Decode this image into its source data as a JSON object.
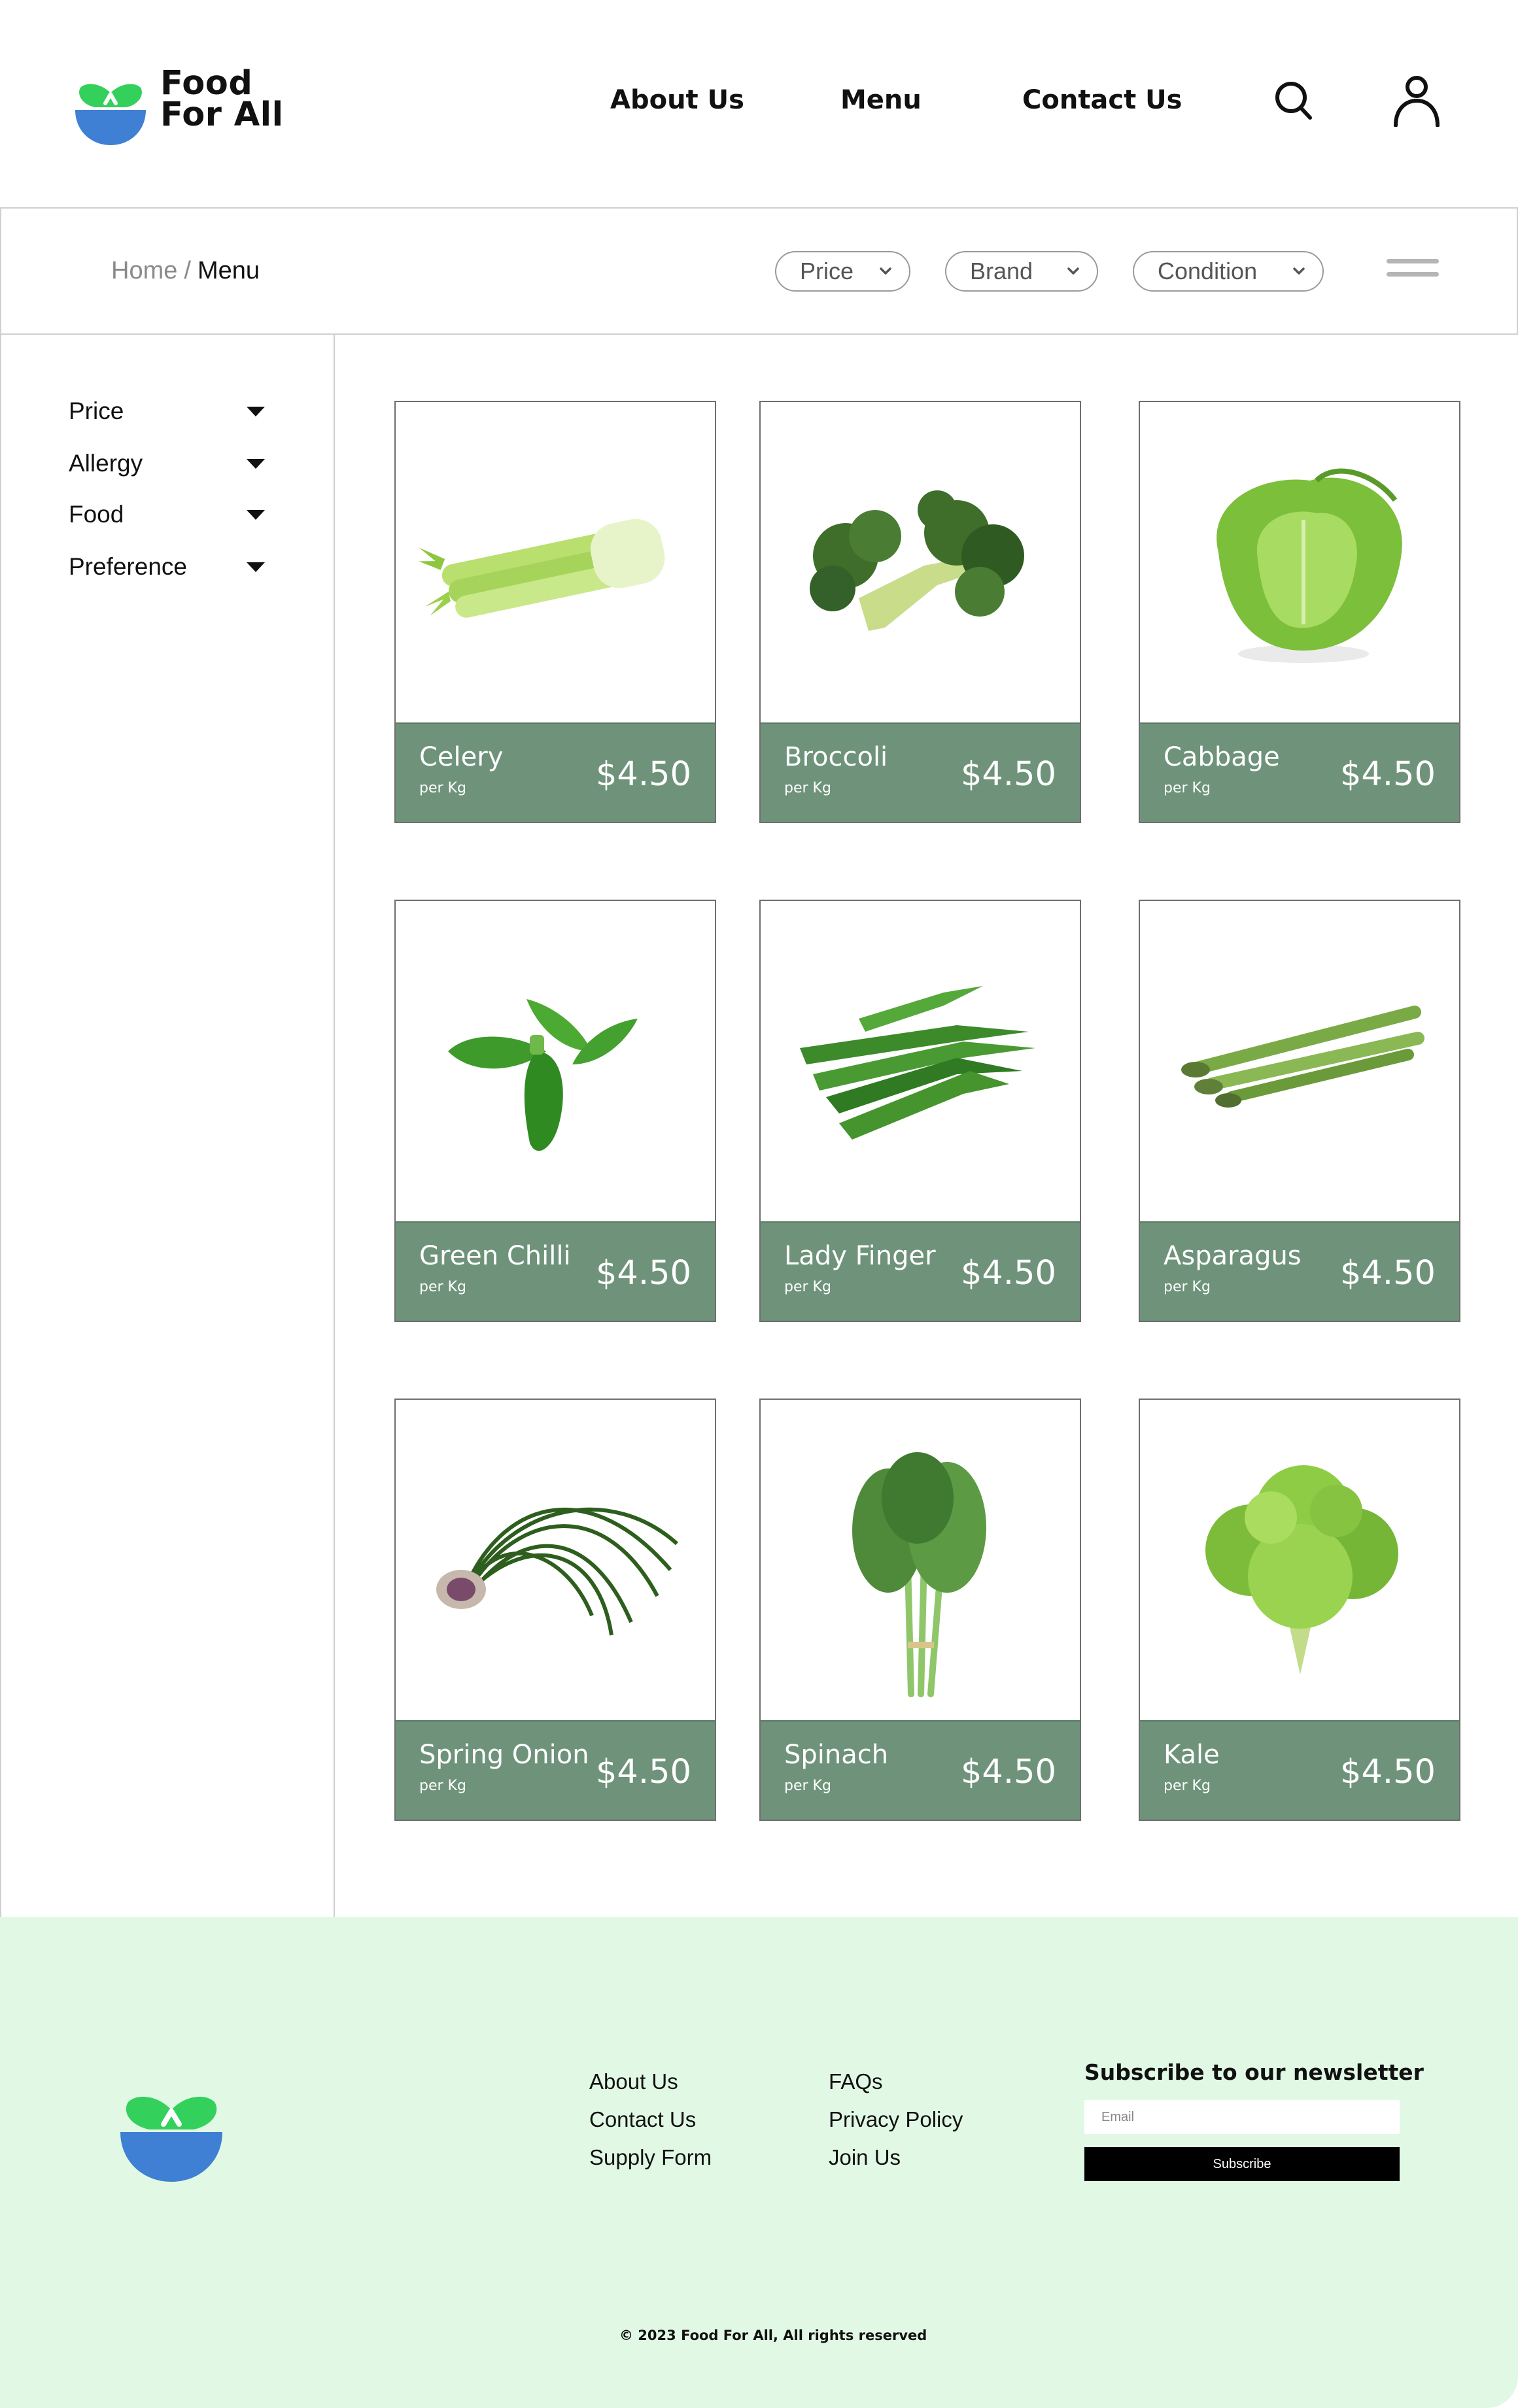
{
  "brand": {
    "line1": "Food",
    "line2": "For All",
    "green": "#33d15c",
    "blue": "#3f7fd4"
  },
  "nav": {
    "about": "About Us",
    "menu": "Menu",
    "contact": "Contact Us"
  },
  "header_icons": {
    "search": "search-icon",
    "user": "user-icon"
  },
  "breadcrumb": {
    "home": "Home",
    "separator": "/",
    "current": "Menu"
  },
  "toolbar_filters": [
    "Price",
    "Brand",
    "Condition"
  ],
  "sidebar_filters": [
    "Price",
    "Allergy",
    "Food",
    "Preference"
  ],
  "card_bar_color": "#6e937a",
  "products": [
    {
      "name": "Celery",
      "unit": "per Kg",
      "price": "$4.50"
    },
    {
      "name": "Broccoli",
      "unit": "per Kg",
      "price": "$4.50"
    },
    {
      "name": "Cabbage",
      "unit": "per Kg",
      "price": "$4.50"
    },
    {
      "name": "Green Chilli",
      "unit": "per Kg",
      "price": "$4.50"
    },
    {
      "name": "Lady Finger",
      "unit": "per Kg",
      "price": "$4.50"
    },
    {
      "name": "Asparagus",
      "unit": "per Kg",
      "price": "$4.50"
    },
    {
      "name": "Spring Onion",
      "unit": "per Kg",
      "price": "$4.50"
    },
    {
      "name": "Spinach",
      "unit": "per Kg",
      "price": "$4.50"
    },
    {
      "name": "Kale",
      "unit": "per Kg",
      "price": "$4.50"
    }
  ],
  "footer": {
    "col1": [
      "About Us",
      "Contact Us",
      "Supply Form"
    ],
    "col2": [
      "FAQs",
      "Privacy Policy",
      "Join Us"
    ],
    "newsletter_title": "Subscribe to our newsletter",
    "email_placeholder": "Email",
    "subscribe_label": "Subscribe",
    "copyright": "© 2023 Food For All, All rights reserved",
    "background": "#e1f9e4"
  }
}
